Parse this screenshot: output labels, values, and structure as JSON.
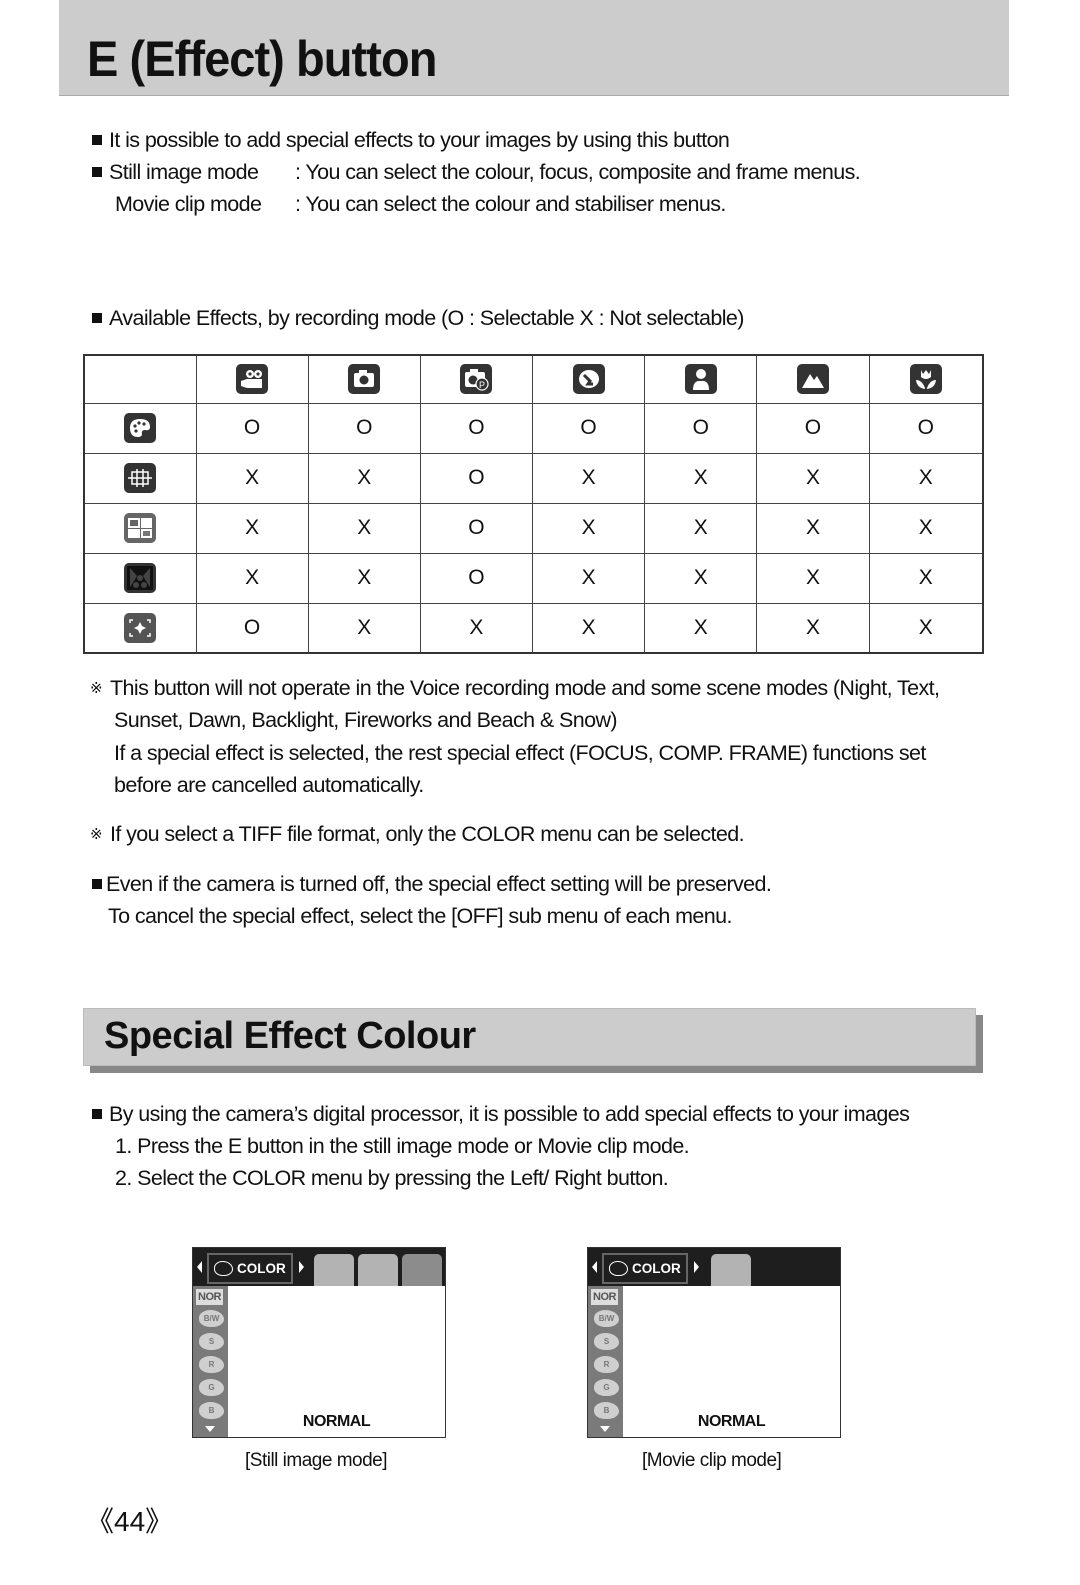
{
  "page": {
    "title": "E (Effect) button",
    "intro": [
      "It is possible to add special effects to your images by using this button",
      {
        "label": "Still image mode",
        "text": ": You can select the colour, focus, composite and frame menus."
      },
      {
        "label": "Movie clip mode",
        "text": ": You can select the colour and stabiliser menus."
      }
    ],
    "available_heading": "Available Effects, by recording mode (O : Selectable X : Not selectable)",
    "table": {
      "columns": [
        {
          "icon": "movie-clip-mode-icon"
        },
        {
          "icon": "auto-mode-icon"
        },
        {
          "icon": "program-mode-icon"
        },
        {
          "icon": "night-scene-mode-icon"
        },
        {
          "icon": "portrait-mode-icon"
        },
        {
          "icon": "landscape-mode-icon"
        },
        {
          "icon": "macro-mode-icon"
        }
      ],
      "rows": [
        {
          "icon": "colour-effect-icon",
          "values": [
            "O",
            "O",
            "O",
            "O",
            "O",
            "O",
            "O"
          ]
        },
        {
          "icon": "focus-effect-icon",
          "values": [
            "X",
            "X",
            "O",
            "X",
            "X",
            "X",
            "X"
          ]
        },
        {
          "icon": "composite-effect-icon",
          "values": [
            "X",
            "X",
            "O",
            "X",
            "X",
            "X",
            "X"
          ]
        },
        {
          "icon": "frame-effect-icon",
          "values": [
            "X",
            "X",
            "O",
            "X",
            "X",
            "X",
            "X"
          ]
        },
        {
          "icon": "stabiliser-effect-icon",
          "values": [
            "O",
            "X",
            "X",
            "X",
            "X",
            "X",
            "X"
          ]
        }
      ]
    },
    "notes": {
      "note1_mark": "※",
      "note1_line1": "This button will not operate in the Voice recording mode and some scene modes (Night, Text,",
      "note1_line2": "Sunset, Dawn, Backlight, Fireworks and Beach & Snow)",
      "note1_line3": "If a special effect is selected, the rest special effect (FOCUS, COMP. FRAME) functions set",
      "note1_line4": "before are cancelled automatically.",
      "note2_mark": "※",
      "note2": "If you select a TIFF file format, only the COLOR menu can be selected.",
      "note3_line1": "Even if the camera is turned off, the special effect setting will be preserved.",
      "note3_line2": "To cancel the special effect, select the [OFF] sub menu of each menu."
    },
    "section_title": "Special Effect  Colour",
    "section_intro": "By using the camera’s digital processor, it is possible to add special effects to your images",
    "steps": [
      "1. Press the E button in the still image mode or Movie clip mode.",
      "2. Select the COLOR menu by pressing the Left/ Right button."
    ],
    "screens": [
      {
        "menu_label": "COLOR",
        "side_top": "NOR",
        "side_items": [
          "B/W",
          "S",
          "R",
          "G",
          "B"
        ],
        "status": "NORMAL",
        "caption": "[Still image mode]"
      },
      {
        "menu_label": "COLOR",
        "side_top": "NOR",
        "side_items": [
          "B/W",
          "S",
          "R",
          "G",
          "B"
        ],
        "status": "NORMAL",
        "caption": "[Movie clip mode]"
      }
    ],
    "page_number": "《44》"
  }
}
